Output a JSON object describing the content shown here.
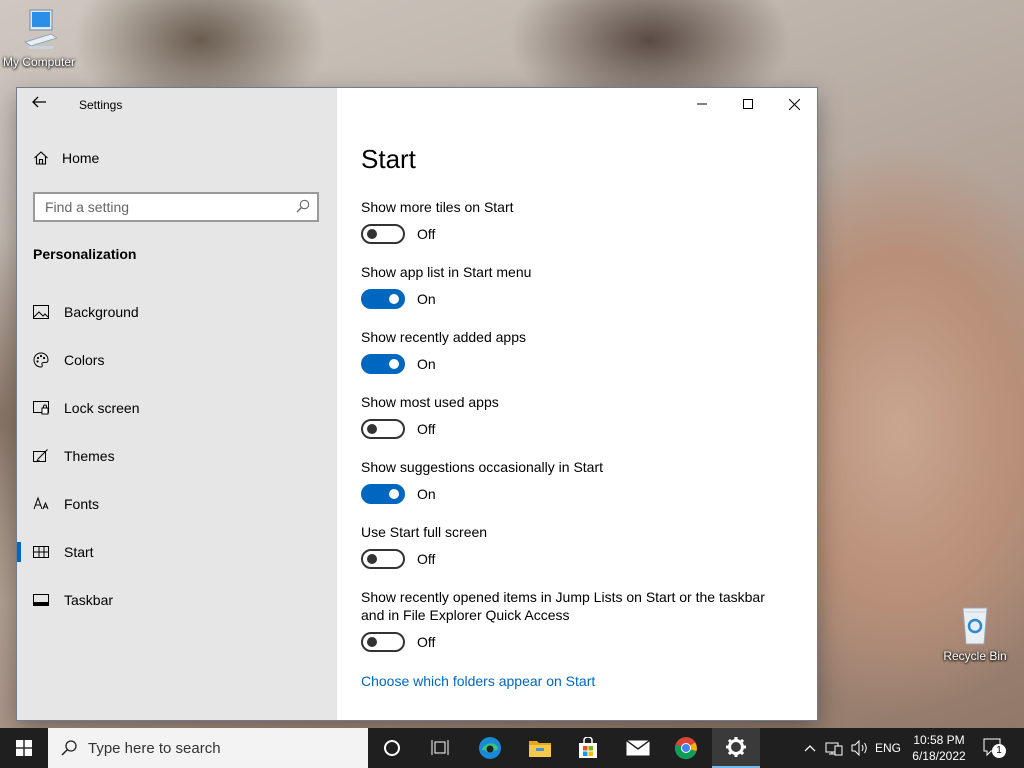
{
  "desktop": {
    "icons": [
      {
        "label": "My Computer"
      },
      {
        "label": "Recycle Bin"
      }
    ]
  },
  "window": {
    "title": "Settings",
    "back_icon": "arrow-left-icon",
    "caption_buttons": [
      "minimize-icon",
      "maximize-icon",
      "close-icon"
    ]
  },
  "nav": {
    "home_label": "Home",
    "search_placeholder": "Find a setting",
    "section": "Personalization",
    "active": "Start",
    "items": [
      {
        "label": "Background",
        "icon": "picture-icon"
      },
      {
        "label": "Colors",
        "icon": "palette-icon"
      },
      {
        "label": "Lock screen",
        "icon": "lock-screen-icon"
      },
      {
        "label": "Themes",
        "icon": "brush-icon"
      },
      {
        "label": "Fonts",
        "icon": "fonts-icon"
      },
      {
        "label": "Start",
        "icon": "start-tiles-icon"
      },
      {
        "label": "Taskbar",
        "icon": "taskbar-icon"
      }
    ]
  },
  "main": {
    "title": "Start",
    "settings": [
      {
        "label": "Show more tiles on Start",
        "state": "Off",
        "on": false
      },
      {
        "label": "Show app list in Start menu",
        "state": "On",
        "on": true
      },
      {
        "label": "Show recently added apps",
        "state": "On",
        "on": true
      },
      {
        "label": "Show most used apps",
        "state": "Off",
        "on": false
      },
      {
        "label": "Show suggestions occasionally in Start",
        "state": "On",
        "on": true
      },
      {
        "label": "Use Start full screen",
        "state": "Off",
        "on": false
      },
      {
        "label": "Show recently opened items in Jump Lists on Start or the taskbar and in File Explorer Quick Access",
        "state": "Off",
        "on": false
      }
    ],
    "link": "Choose which folders appear on Start"
  },
  "taskbar": {
    "search_placeholder": "Type here to search",
    "apps": [
      "cortana-icon",
      "task-view-icon",
      "edge-icon",
      "file-explorer-icon",
      "store-icon",
      "mail-icon",
      "chrome-icon",
      "settings-gear-icon"
    ],
    "language": "ENG",
    "time": "10:58 PM",
    "date": "6/18/2022",
    "notification_count": "1"
  },
  "colors": {
    "accent": "#0067c0",
    "nav_background": "#e6e6e6",
    "taskbar": "#1f1f1f"
  }
}
